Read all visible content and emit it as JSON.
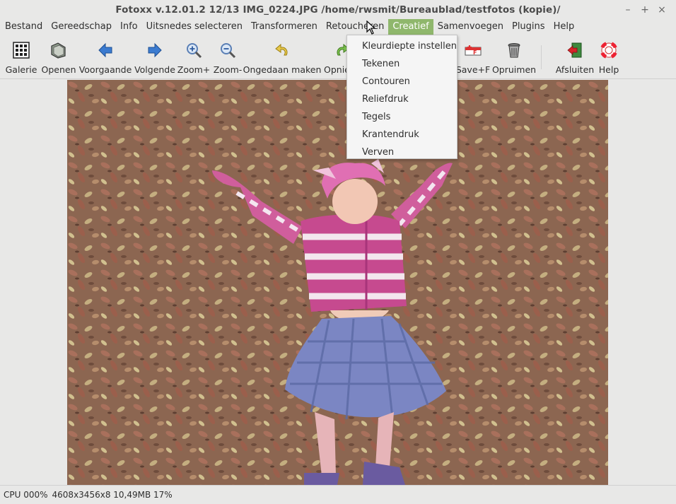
{
  "window": {
    "title": "Fotoxx v.12.01.2   12/13  IMG_0224.JPG  /home/rwsmit/Bureaublad/testfotos (kopie)/",
    "controls": [
      "–",
      "+",
      "×"
    ]
  },
  "menubar": [
    {
      "label": "Bestand"
    },
    {
      "label": "Gereedschap"
    },
    {
      "label": "Info"
    },
    {
      "label": "Uitsnedes selecteren"
    },
    {
      "label": "Transformeren"
    },
    {
      "label": "Retoucheren"
    },
    {
      "label": "Creatief",
      "active": true
    },
    {
      "label": "Samenvoegen"
    },
    {
      "label": "Plugins"
    },
    {
      "label": "Help"
    }
  ],
  "toolbar": {
    "galerie": "Galerie",
    "openen": "Openen",
    "voorgaande": "Voorgaande",
    "volgende": "Volgende",
    "zoom_in": "Zoom+",
    "zoom_out": "Zoom-",
    "undo": "Ongedaan maken",
    "redo": "Opnie",
    "save_f": "Save+F",
    "opruimen": "Opruimen",
    "afsluiten": "Afsluiten",
    "help": "Help"
  },
  "dropdown": {
    "items": [
      "Kleurdiepte instellen",
      "Tekenen",
      "Contouren",
      "Reliefdruk",
      "Tegels",
      "Krantendruk",
      "Verven"
    ]
  },
  "statusbar": {
    "cpu": "CPU 000%",
    "info": "4608x3456x8 10,49MB 17%"
  },
  "colors": {
    "menu_active": "#8fb76c",
    "background": "#e8e8e7"
  }
}
